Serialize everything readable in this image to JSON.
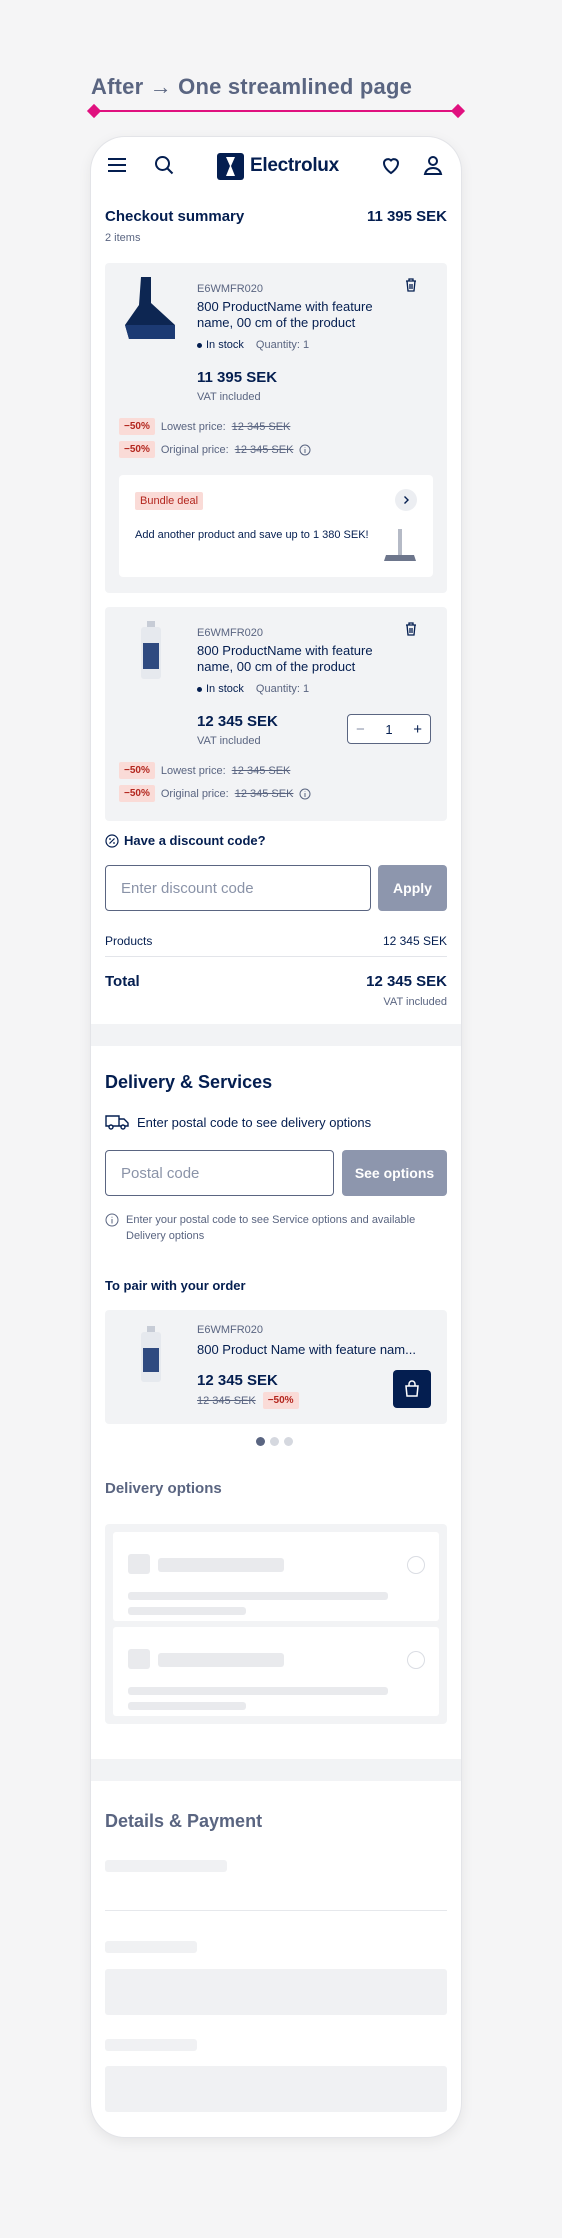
{
  "annotation": {
    "title": "After → One streamlined page"
  },
  "header": {
    "brand": "Electrolux"
  },
  "checkout": {
    "title": "Checkout summary",
    "total": "11 395 SEK",
    "items_count": "2 items",
    "items": [
      {
        "sku": "E6WMFR020",
        "name": "800 ProductName with feature name, 00 cm of the product",
        "stock": "In stock",
        "quantity_label": "Quantity: 1",
        "price": "11 395 SEK",
        "vat": "VAT included",
        "discount_badge": "−50%",
        "lowest_label": "Lowest price:",
        "lowest_value": "12 345 SEK",
        "original_label": "Original price:",
        "original_value": "12 345 SEK",
        "bundle": {
          "badge": "Bundle deal",
          "text": "Add another product and save up to 1 380 SEK!"
        }
      },
      {
        "sku": "E6WMFR020",
        "name": "800 ProductName with feature name, 00 cm of the product",
        "stock": "In stock",
        "quantity_label": "Quantity: 1",
        "price": "12 345 SEK",
        "vat": "VAT included",
        "quantity": "1",
        "discount_badge": "−50%",
        "lowest_label": "Lowest price:",
        "lowest_value": "12 345 SEK",
        "original_label": "Original price:",
        "original_value": "12 345 SEK"
      }
    ],
    "discount": {
      "title": "Have a discount code?",
      "placeholder": "Enter discount code",
      "apply": "Apply"
    },
    "products_label": "Products",
    "products_value": "12 345 SEK",
    "total_label": "Total",
    "total_value": "12 345 SEK",
    "total_vat": "VAT included"
  },
  "delivery": {
    "title": "Delivery & Services",
    "prompt": "Enter postal code to see delivery options",
    "placeholder": "Postal code",
    "see_options": "See options",
    "info": "Enter your postal code to see Service options and available Delivery options",
    "pair_title": "To pair with your order",
    "pair_item": {
      "sku": "E6WMFR020",
      "name": "800 Product Name with feature nam...",
      "price": "12 345 SEK",
      "old_price": "12 345 SEK",
      "badge": "−50%"
    },
    "options_title": "Delivery options"
  },
  "payment": {
    "title": "Details & Payment"
  },
  "colors": {
    "navy": "#041e50",
    "accent": "#e0117f",
    "discount_bg": "#fadbd7",
    "button_disabled": "#8d96ad"
  }
}
